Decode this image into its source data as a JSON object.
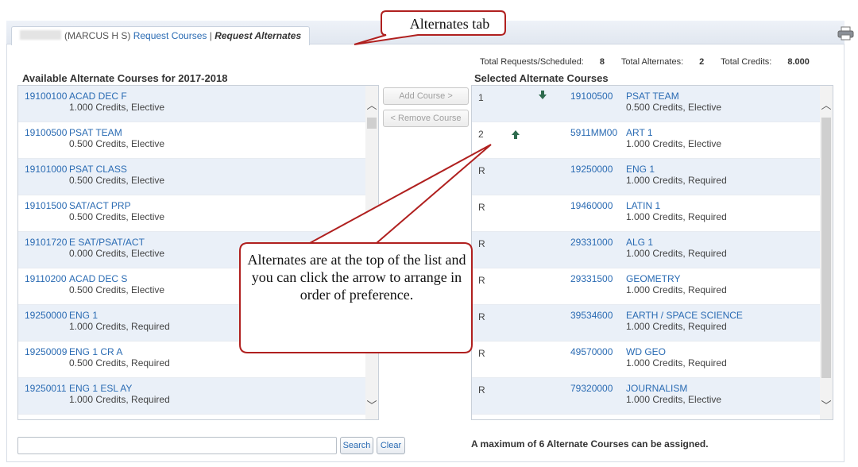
{
  "tab": {
    "user_label": "(MARCUS H S)",
    "request_courses": "Request Courses",
    "separator": "|",
    "request_alternates": "Request Alternates"
  },
  "totals": {
    "requests_label": "Total Requests/Scheduled:",
    "requests_value": "8",
    "alternates_label": "Total Alternates:",
    "alternates_value": "2",
    "credits_label": "Total Credits:",
    "credits_value": "8.000"
  },
  "available": {
    "heading": "Available Alternate Courses for 2017-2018",
    "rows": [
      {
        "code": "19100100",
        "title": "ACAD DEC F",
        "info": "1.000 Credits,  Elective"
      },
      {
        "code": "19100500",
        "title": "PSAT TEAM",
        "info": "0.500 Credits,  Elective"
      },
      {
        "code": "19101000",
        "title": "PSAT CLASS",
        "info": "0.500 Credits,  Elective"
      },
      {
        "code": "19101500",
        "title": "SAT/ACT PRP",
        "info": "0.500 Credits,  Elective"
      },
      {
        "code": "19101720",
        "title": "E SAT/PSAT/ACT",
        "info": "0.000 Credits,  Elective"
      },
      {
        "code": "19110200",
        "title": "ACAD DEC S",
        "info": "0.500 Credits,  Elective"
      },
      {
        "code": "19250000",
        "title": "ENG 1",
        "info": "1.000 Credits,  Required"
      },
      {
        "code": "19250009",
        "title": "ENG 1 CR A",
        "info": "0.500 Credits,  Required"
      },
      {
        "code": "19250011",
        "title": "ENG 1 ESL AY",
        "info": "1.000 Credits,  Required"
      }
    ]
  },
  "buttons": {
    "add_course": "Add Course >",
    "remove_course": "< Remove Course",
    "search": "Search",
    "clear": "Clear"
  },
  "search": {
    "value": "",
    "placeholder": ""
  },
  "selected": {
    "heading": "Selected Alternate Courses",
    "rows": [
      {
        "rank": "1",
        "code": "19100500",
        "title": "PSAT TEAM",
        "info": "0.500 Credits,  Elective",
        "arrow": "down"
      },
      {
        "rank": "2",
        "code": "5911MM00",
        "title": "ART 1",
        "info": "1.000 Credits,  Elective",
        "arrow": "up"
      },
      {
        "rank": "R",
        "code": "19250000",
        "title": "ENG 1",
        "info": "1.000 Credits,  Required"
      },
      {
        "rank": "R",
        "code": "19460000",
        "title": "LATIN 1",
        "info": "1.000 Credits,  Required"
      },
      {
        "rank": "R",
        "code": "29331000",
        "title": "ALG 1",
        "info": "1.000 Credits,  Required"
      },
      {
        "rank": "R",
        "code": "29331500",
        "title": "GEOMETRY",
        "info": "1.000 Credits,  Required"
      },
      {
        "rank": "R",
        "code": "39534600",
        "title": "EARTH / SPACE SCIENCE",
        "info": "1.000 Credits,  Required"
      },
      {
        "rank": "R",
        "code": "49570000",
        "title": "WD GEO",
        "info": "1.000 Credits,  Required"
      },
      {
        "rank": "R",
        "code": "79320000",
        "title": "JOURNALISM",
        "info": "1.000 Credits,  Elective"
      }
    ]
  },
  "max_note": "A maximum of 6 Alternate Courses can be assigned.",
  "callouts": {
    "tab": "Alternates tab",
    "arrows": "Alternates are at the top of the list and you can click the arrow to arrange in order of preference."
  },
  "colors": {
    "link": "#2a6bb3",
    "row_alt": "#eaf0f8",
    "callout_border": "#b0201f",
    "arrow": "#2e6b4e"
  }
}
